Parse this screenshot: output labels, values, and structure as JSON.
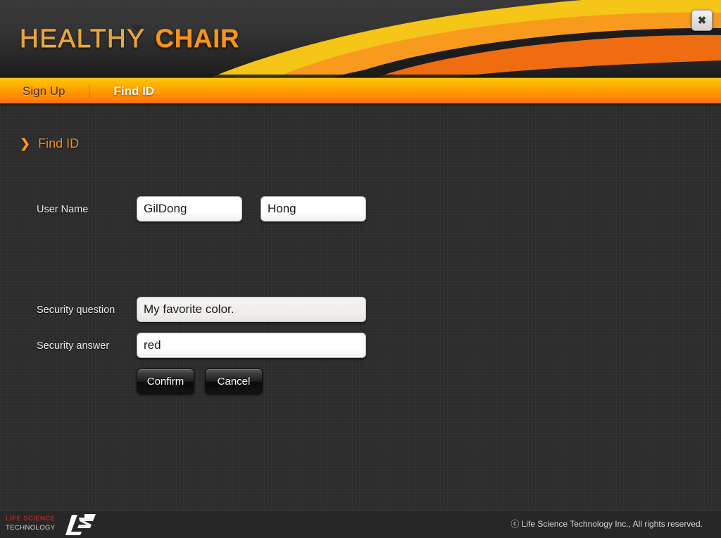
{
  "window": {
    "close_label": "✖"
  },
  "header": {
    "logo_part1": "HEALTHY",
    "logo_part2": "CHAIR",
    "logo_color_1": "#e8a33a",
    "logo_color_2": "#f7941d",
    "swoosh_colors": [
      "#f5c518",
      "#f79a1e",
      "#ef6c11",
      "#1c1c1c"
    ]
  },
  "nav": {
    "items": [
      {
        "label": "Sign Up",
        "active": false
      },
      {
        "label": "Find ID",
        "active": true
      }
    ],
    "bar_color_top": "#ffc40a",
    "bar_color_bottom": "#ff7410"
  },
  "section": {
    "icon": "chevron-right-icon",
    "title": "Find ID",
    "title_color": "#f0901c"
  },
  "form": {
    "fields": [
      {
        "label": "User Name",
        "inputs": [
          {
            "name": "first-name",
            "value": "GilDong",
            "placeholder": "",
            "readonly": false
          },
          {
            "name": "last-name",
            "value": "Hong",
            "placeholder": "",
            "readonly": false
          }
        ]
      },
      {
        "label": "Security question",
        "inputs": [
          {
            "name": "security-question",
            "value": "My favorite color.",
            "placeholder": "",
            "readonly": true
          }
        ]
      },
      {
        "label": "Security answer",
        "inputs": [
          {
            "name": "security-answer",
            "value": "red",
            "placeholder": "",
            "readonly": false
          }
        ]
      }
    ],
    "buttons": [
      {
        "name": "confirm",
        "label": "Confirm"
      },
      {
        "name": "cancel",
        "label": "Cancel"
      }
    ]
  },
  "footer": {
    "logo_line1": "LIFE SCIENCE",
    "logo_line2": "TECHNOLOGY",
    "logo_mark": "LST",
    "copyright": "ⓒ Life Science Technology Inc., All rights reserved."
  }
}
